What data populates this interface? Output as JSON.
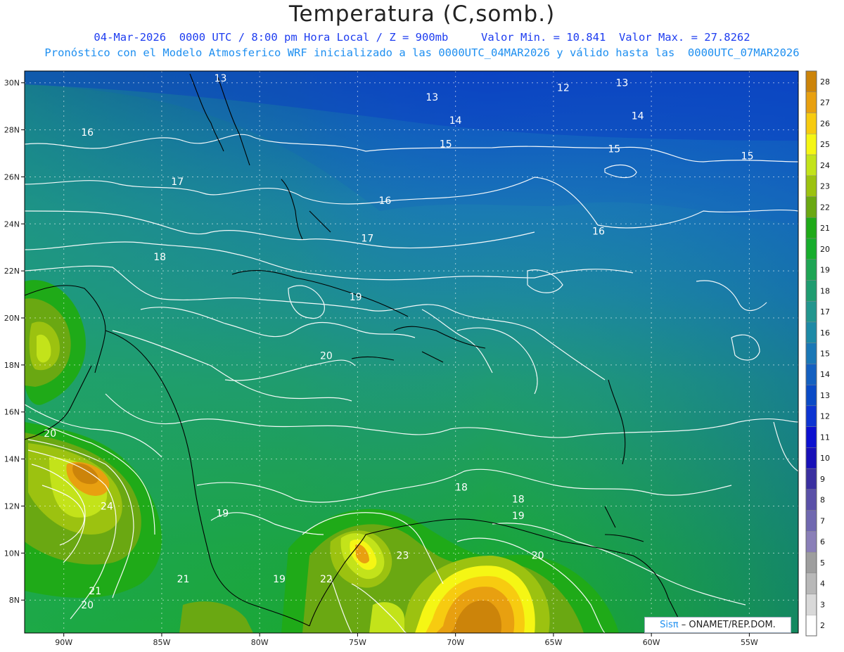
{
  "title": "Temperatura (C,somb.)",
  "subtitle_line1": "04-Mar-2026  0000 UTC / 8:00 pm Hora Local / Z = 900mb     Valor Min. = 10.841  Valor Max. = 27.8262",
  "subtitle_line2": "Pronóstico con el Modelo Atmosferico WRF inicializado a las 0000UTC_04MAR2026 y válido hasta las  0000UTC_07MAR2026",
  "credit": {
    "brand": "Sisπ",
    "org": "– ONAMET/REP.DOM."
  },
  "map": {
    "lon_range": [
      -92,
      -52.5
    ],
    "lat_range": [
      6.6,
      30.5
    ],
    "lon_ticks": [
      {
        "value": -90,
        "label": "90W"
      },
      {
        "value": -85,
        "label": "85W"
      },
      {
        "value": -80,
        "label": "80W"
      },
      {
        "value": -75,
        "label": "75W"
      },
      {
        "value": -70,
        "label": "70W"
      },
      {
        "value": -65,
        "label": "65W"
      },
      {
        "value": -60,
        "label": "60W"
      },
      {
        "value": -55,
        "label": "55W"
      }
    ],
    "lat_ticks": [
      {
        "value": 30,
        "label": "30N"
      },
      {
        "value": 28,
        "label": "28N"
      },
      {
        "value": 26,
        "label": "26N"
      },
      {
        "value": 24,
        "label": "24N"
      },
      {
        "value": 22,
        "label": "22N"
      },
      {
        "value": 20,
        "label": "20N"
      },
      {
        "value": 18,
        "label": "18N"
      },
      {
        "value": 16,
        "label": "16N"
      },
      {
        "value": 14,
        "label": "14N"
      },
      {
        "value": 12,
        "label": "12N"
      },
      {
        "value": 10,
        "label": "10N"
      },
      {
        "value": 8,
        "label": "8N"
      }
    ],
    "grid": true,
    "contour_labels": [
      {
        "lon": -82.0,
        "lat": 30.2,
        "text": "13"
      },
      {
        "lon": -71.2,
        "lat": 29.4,
        "text": "13"
      },
      {
        "lon": -64.5,
        "lat": 29.8,
        "text": "12"
      },
      {
        "lon": -61.5,
        "lat": 30.0,
        "text": "13"
      },
      {
        "lon": -70.0,
        "lat": 28.4,
        "text": "14"
      },
      {
        "lon": -60.7,
        "lat": 28.6,
        "text": "14"
      },
      {
        "lon": -88.8,
        "lat": 27.9,
        "text": "16"
      },
      {
        "lon": -70.5,
        "lat": 27.4,
        "text": "15"
      },
      {
        "lon": -61.9,
        "lat": 27.2,
        "text": "15"
      },
      {
        "lon": -55.1,
        "lat": 26.9,
        "text": "15"
      },
      {
        "lon": -84.2,
        "lat": 25.8,
        "text": "17"
      },
      {
        "lon": -73.6,
        "lat": 25.0,
        "text": "16"
      },
      {
        "lon": -62.7,
        "lat": 23.7,
        "text": "16"
      },
      {
        "lon": -74.5,
        "lat": 23.4,
        "text": "17"
      },
      {
        "lon": -85.1,
        "lat": 22.6,
        "text": "18"
      },
      {
        "lon": -75.1,
        "lat": 20.9,
        "text": "19"
      },
      {
        "lon": -76.6,
        "lat": 18.4,
        "text": "20"
      },
      {
        "lon": -90.7,
        "lat": 15.1,
        "text": "20"
      },
      {
        "lon": -87.8,
        "lat": 12.0,
        "text": "24"
      },
      {
        "lon": -69.7,
        "lat": 12.8,
        "text": "18"
      },
      {
        "lon": -66.8,
        "lat": 12.3,
        "text": "18"
      },
      {
        "lon": -66.8,
        "lat": 11.6,
        "text": "19"
      },
      {
        "lon": -81.9,
        "lat": 11.7,
        "text": "19"
      },
      {
        "lon": -72.7,
        "lat": 9.9,
        "text": "23"
      },
      {
        "lon": -65.8,
        "lat": 9.9,
        "text": "20"
      },
      {
        "lon": -83.9,
        "lat": 8.9,
        "text": "21"
      },
      {
        "lon": -79.0,
        "lat": 8.9,
        "text": "19"
      },
      {
        "lon": -76.6,
        "lat": 8.9,
        "text": "22"
      },
      {
        "lon": -88.4,
        "lat": 8.4,
        "text": "21"
      },
      {
        "lon": -88.8,
        "lat": 7.8,
        "text": "20"
      }
    ]
  },
  "colorbar": {
    "levels": [
      2,
      3,
      4,
      5,
      6,
      7,
      8,
      9,
      10,
      11,
      12,
      13,
      14,
      15,
      16,
      17,
      18,
      19,
      20,
      21,
      22,
      23,
      24,
      25,
      26,
      27,
      28
    ],
    "colors": [
      "#ffffff",
      "#d9d9d9",
      "#b8b8b8",
      "#9e9e9e",
      "#8a7fb8",
      "#7068b0",
      "#5a50a8",
      "#3a2fa0",
      "#1810b8",
      "#0c10d0",
      "#0d34d2",
      "#0a4ac6",
      "#1460c0",
      "#1a78b6",
      "#1d8aa6",
      "#22968e",
      "#1f9c70",
      "#1ea554",
      "#17ad2c",
      "#1faa18",
      "#6aa812",
      "#9cc210",
      "#c3e31a",
      "#f5f614",
      "#f7cb10",
      "#e8a010",
      "#cc840a"
    ]
  }
}
